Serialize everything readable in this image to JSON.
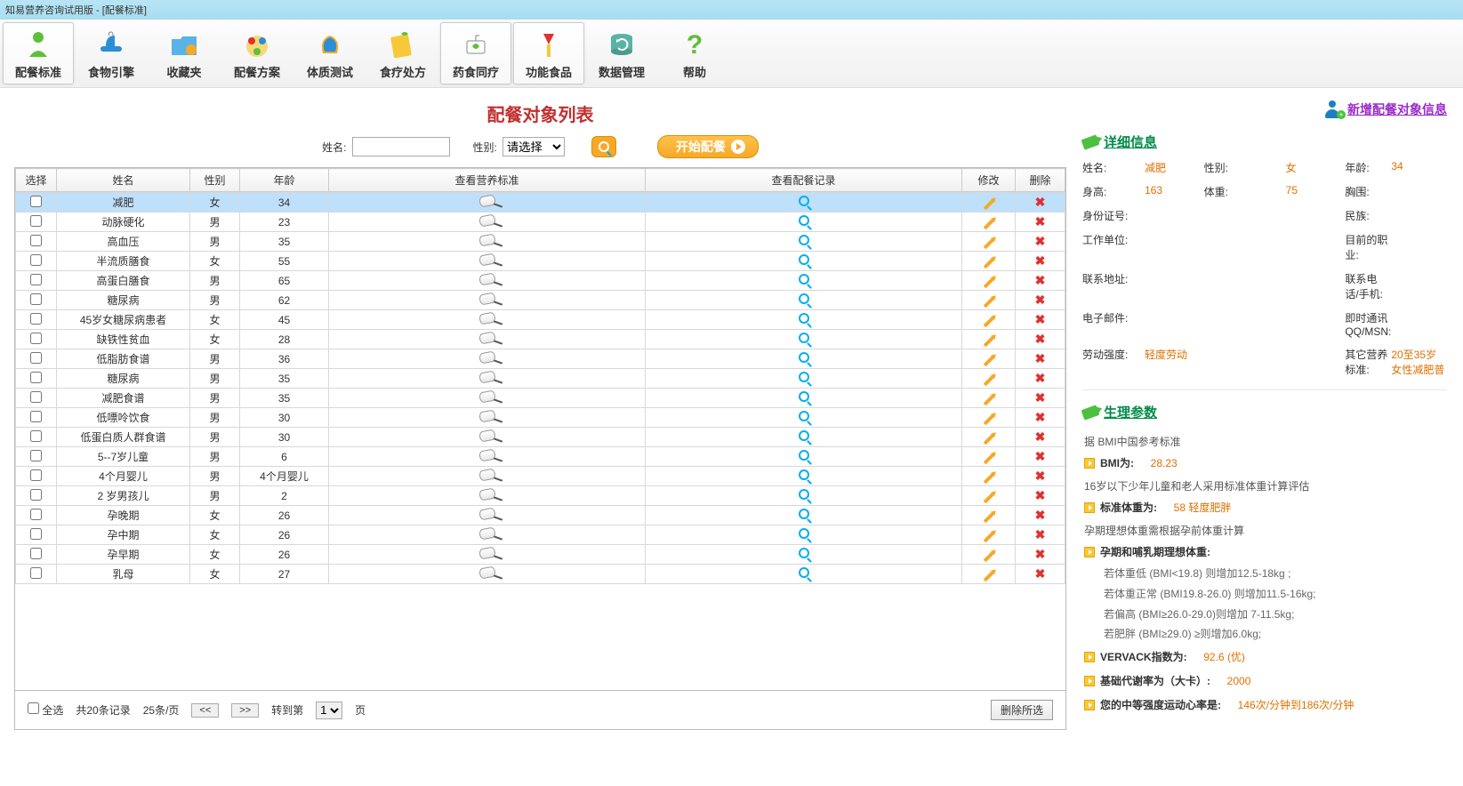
{
  "window_title": "知易营养咨询试用版 - [配餐标准]",
  "toolbar": [
    {
      "id": "tb-standard",
      "label": "配餐标准",
      "active": true
    },
    {
      "id": "tb-food",
      "label": "食物引擎"
    },
    {
      "id": "tb-fav",
      "label": "收藏夹"
    },
    {
      "id": "tb-plan",
      "label": "配餐方案"
    },
    {
      "id": "tb-body",
      "label": "体质测试"
    },
    {
      "id": "tb-diet",
      "label": "食疗处方"
    },
    {
      "id": "tb-med",
      "label": "药食同疗",
      "active": true
    },
    {
      "id": "tb-func",
      "label": "功能食品",
      "active": true
    },
    {
      "id": "tb-data",
      "label": "数据管理"
    },
    {
      "id": "tb-help",
      "label": "帮助"
    }
  ],
  "center": {
    "title": "配餐对象列表",
    "name_label": "姓名:",
    "gender_label": "性别:",
    "gender_placeholder": "请选择",
    "start_btn": "开始配餐",
    "headers": [
      "选择",
      "姓名",
      "性别",
      "年龄",
      "查看营养标准",
      "查看配餐记录",
      "修改",
      "删除"
    ],
    "rows": [
      {
        "name": "减肥",
        "gender": "女",
        "age": "34",
        "selected": true
      },
      {
        "name": "动脉硬化",
        "gender": "男",
        "age": "23"
      },
      {
        "name": "高血压",
        "gender": "男",
        "age": "35"
      },
      {
        "name": "半流质膳食",
        "gender": "女",
        "age": "55"
      },
      {
        "name": "高蛋白膳食",
        "gender": "男",
        "age": "65"
      },
      {
        "name": "糖尿病",
        "gender": "男",
        "age": "62"
      },
      {
        "name": "45岁女糖尿病患者",
        "gender": "女",
        "age": "45"
      },
      {
        "name": "缺铁性贫血",
        "gender": "女",
        "age": "28"
      },
      {
        "name": "低脂肪食谱",
        "gender": "男",
        "age": "36"
      },
      {
        "name": "糖尿病",
        "gender": "男",
        "age": "35"
      },
      {
        "name": "减肥食谱",
        "gender": "男",
        "age": "35"
      },
      {
        "name": "低嘌呤饮食",
        "gender": "男",
        "age": "30"
      },
      {
        "name": "低蛋白质人群食谱",
        "gender": "男",
        "age": "30"
      },
      {
        "name": "5--7岁儿童",
        "gender": "男",
        "age": "6"
      },
      {
        "name": "4个月婴儿",
        "gender": "男",
        "age": "4个月婴儿"
      },
      {
        "name": "2 岁男孩儿",
        "gender": "男",
        "age": "2"
      },
      {
        "name": "孕晚期",
        "gender": "女",
        "age": "26"
      },
      {
        "name": "孕中期",
        "gender": "女",
        "age": "26"
      },
      {
        "name": "孕早期",
        "gender": "女",
        "age": "26"
      },
      {
        "name": "乳母",
        "gender": "女",
        "age": "27"
      }
    ]
  },
  "pager": {
    "select_all": "全选",
    "total": "共20条记录",
    "per_page": "25条/页",
    "prev": "<<",
    "next": ">>",
    "goto_label": "转到第",
    "goto_page": "1",
    "page_unit": "页",
    "delete_selected": "删除所选"
  },
  "right": {
    "add_link": "新增配餐对象信息",
    "detail_title": "详细信息",
    "fields": {
      "name_l": "姓名:",
      "name_v": "减肥",
      "gender_l": "性别:",
      "gender_v": "女",
      "age_l": "年龄:",
      "age_v": "34",
      "height_l": "身高:",
      "height_v": "163",
      "weight_l": "体重:",
      "weight_v": "75",
      "chest_l": "胸围:",
      "id_l": "身份证号:",
      "nation_l": "民族:",
      "work_l": "工作单位:",
      "job_l": "目前的职业:",
      "addr_l": "联系地址:",
      "phone_l": "联系电话/手机:",
      "email_l": "电子邮件:",
      "im_l": "即时通讯 QQ/MSN:",
      "labor_l": "劳动强度:",
      "labor_v": "轻度劳动",
      "other_l": "其它营养标准:",
      "other_v": "20至35岁女性减肥普"
    },
    "phy_title": "生理参数",
    "phy_note1": "据 BMI中国参考标准",
    "bmi_l": "BMI为:",
    "bmi_v": "28.23",
    "phy_note2": "16岁以下少年儿童和老人采用标准体重计算评估",
    "stdw_l": "标准体重为:",
    "stdw_v": "58 轻度肥胖",
    "phy_note3": "孕期理想体重需根据孕前体重计算",
    "preg_l": "孕期和哺乳期理想体重:",
    "preg_lines": [
      "若体重低  (BMI<19.8)  则增加12.5-18kg ;",
      "若体重正常  (BMI19.8-26.0) 则增加11.5-16kg;",
      "若偏高  (BMI≥26.0-29.0)则增加 7-11.5kg;",
      "若肥胖  (BMI≥29.0) ≥则增加6.0kg;"
    ],
    "vervack_l": "VERVACK指数为:",
    "vervack_v": "92.6 (优)",
    "bmr_l": "基础代谢率为（大卡）:",
    "bmr_v": "2000",
    "hr_l": "您的中等强度运动心率是:",
    "hr_v": "146次/分钟到186次/分钟"
  }
}
